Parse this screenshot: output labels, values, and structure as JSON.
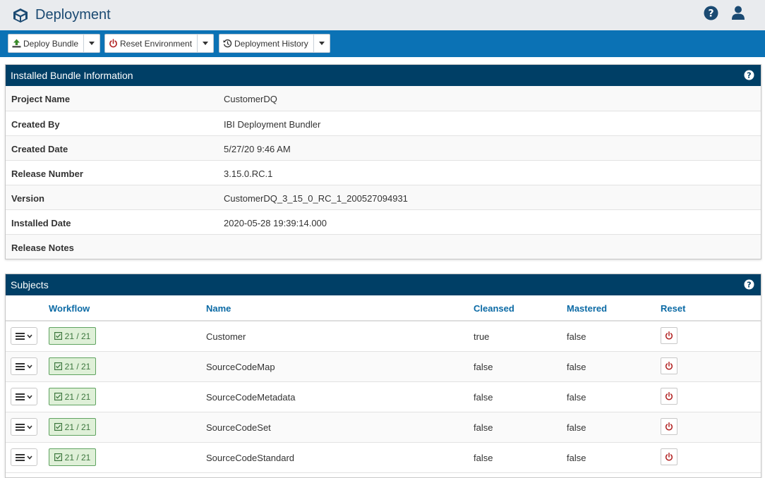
{
  "app": {
    "title": "Deployment",
    "icon": "cube-icon"
  },
  "toolbar": {
    "deploy_bundle": "Deploy Bundle",
    "reset_environment": "Reset Environment",
    "deployment_history": "Deployment History"
  },
  "bundle_panel": {
    "title": "Installed Bundle Information",
    "rows": [
      {
        "label": "Project Name",
        "value": "CustomerDQ"
      },
      {
        "label": "Created By",
        "value": "IBI Deployment Bundler"
      },
      {
        "label": "Created Date",
        "value": "5/27/20 9:46 AM"
      },
      {
        "label": "Release Number",
        "value": "3.15.0.RC.1"
      },
      {
        "label": "Version",
        "value": "CustomerDQ_3_15_0_RC_1_200527094931"
      },
      {
        "label": "Installed Date",
        "value": "2020-05-28 19:39:14.000"
      },
      {
        "label": "Release Notes",
        "value": ""
      }
    ]
  },
  "subjects_panel": {
    "title": "Subjects",
    "columns": {
      "workflow": "Workflow",
      "name": "Name",
      "cleansed": "Cleansed",
      "mastered": "Mastered",
      "reset": "Reset"
    },
    "rows": [
      {
        "workflow": "21 / 21",
        "name": "Customer",
        "cleansed": "true",
        "mastered": "false"
      },
      {
        "workflow": "21 / 21",
        "name": "SourceCodeMap",
        "cleansed": "false",
        "mastered": "false"
      },
      {
        "workflow": "21 / 21",
        "name": "SourceCodeMetadata",
        "cleansed": "false",
        "mastered": "false"
      },
      {
        "workflow": "21 / 21",
        "name": "SourceCodeSet",
        "cleansed": "false",
        "mastered": "false"
      },
      {
        "workflow": "21 / 21",
        "name": "SourceCodeStandard",
        "cleansed": "false",
        "mastered": "false"
      }
    ]
  },
  "colors": {
    "title_text": "#1b4a72",
    "toolbar_bg": "#0b72b5",
    "panel_header_bg": "#003f66",
    "column_header": "#0b6aa5",
    "workflow_badge_bg": "#dff0d8",
    "reset_icon": "#b22222"
  }
}
